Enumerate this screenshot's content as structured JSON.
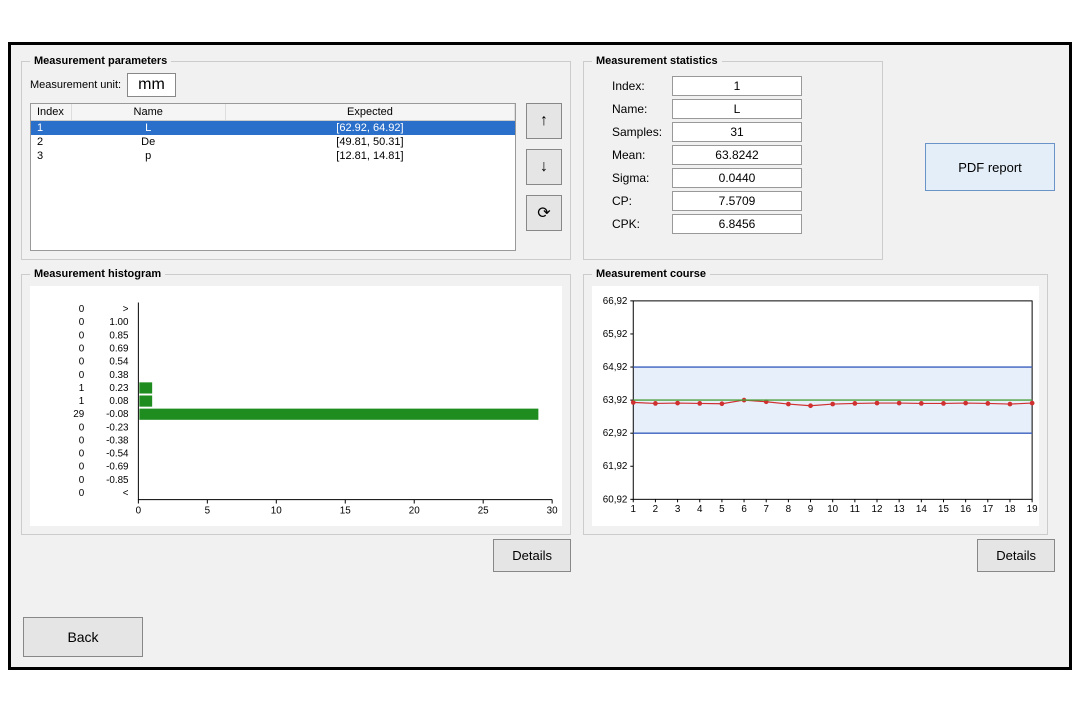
{
  "panels": {
    "parameters_title": "Measurement parameters",
    "statistics_title": "Measurement statistics",
    "histogram_title": "Measurement histogram",
    "course_title": "Measurement course"
  },
  "unit": {
    "label": "Measurement unit:",
    "value": "mm"
  },
  "params_table": {
    "headers": {
      "index": "Index",
      "name": "Name",
      "expected": "Expected"
    },
    "rows": [
      {
        "index": "1",
        "name": "L",
        "expected": "[62.92, 64.92]",
        "selected": true
      },
      {
        "index": "2",
        "name": "De",
        "expected": "[49.81, 50.31]",
        "selected": false
      },
      {
        "index": "3",
        "name": "p",
        "expected": "[12.81, 14.81]",
        "selected": false
      }
    ]
  },
  "icons": {
    "arrow_up": "↑",
    "arrow_down": "↓",
    "refresh": "⟳"
  },
  "statistics": {
    "index": {
      "label": "Index:",
      "value": "1"
    },
    "name": {
      "label": "Name:",
      "value": "L"
    },
    "samples": {
      "label": "Samples:",
      "value": "31"
    },
    "mean": {
      "label": "Mean:",
      "value": "63.8242"
    },
    "sigma": {
      "label": "Sigma:",
      "value": "0.0440"
    },
    "cp": {
      "label": "CP:",
      "value": "7.5709"
    },
    "cpk": {
      "label": "CPK:",
      "value": "6.8456"
    }
  },
  "buttons": {
    "pdf_report": "PDF report",
    "details": "Details",
    "back": "Back"
  },
  "chart_data": [
    {
      "type": "bar",
      "id": "histogram",
      "orientation": "horizontal",
      "bin_labels_inner": [
        ">",
        "1.00",
        "0.85",
        "0.69",
        "0.54",
        "0.38",
        "0.23",
        "0.08",
        "-0.08",
        "-0.23",
        "-0.38",
        "-0.54",
        "-0.69",
        "-0.85",
        "<"
      ],
      "bin_counts": [
        0,
        0,
        0,
        0,
        0,
        0,
        1,
        1,
        29,
        0,
        0,
        0,
        0,
        0,
        0
      ],
      "x_ticks": [
        0,
        5,
        10,
        15,
        20,
        25,
        30
      ],
      "xlim": [
        0,
        30
      ]
    },
    {
      "type": "line",
      "id": "course",
      "x": [
        1,
        2,
        3,
        4,
        5,
        6,
        7,
        8,
        9,
        10,
        11,
        12,
        13,
        14,
        15,
        16,
        17,
        18,
        19
      ],
      "x_ticks": [
        1,
        2,
        3,
        4,
        5,
        6,
        7,
        8,
        9,
        10,
        11,
        12,
        13,
        14,
        15,
        16,
        17,
        18,
        19
      ],
      "series": [
        {
          "name": "measured",
          "color": "#d03030",
          "markers": true,
          "values": [
            63.85,
            63.82,
            63.83,
            63.82,
            63.81,
            63.92,
            63.87,
            63.8,
            63.75,
            63.8,
            63.82,
            63.83,
            63.83,
            63.82,
            63.82,
            63.83,
            63.82,
            63.8,
            63.83
          ]
        },
        {
          "name": "lower_limit",
          "color": "#3a5fbf",
          "markers": false,
          "values": [
            62.92,
            62.92,
            62.92,
            62.92,
            62.92,
            62.92,
            62.92,
            62.92,
            62.92,
            62.92,
            62.92,
            62.92,
            62.92,
            62.92,
            62.92,
            62.92,
            62.92,
            62.92,
            62.92
          ]
        },
        {
          "name": "upper_limit",
          "color": "#3a5fbf",
          "markers": false,
          "values": [
            64.92,
            64.92,
            64.92,
            64.92,
            64.92,
            64.92,
            64.92,
            64.92,
            64.92,
            64.92,
            64.92,
            64.92,
            64.92,
            64.92,
            64.92,
            64.92,
            64.92,
            64.92,
            64.92
          ]
        },
        {
          "name": "mean_line",
          "color": "#4aa03a",
          "markers": false,
          "values": [
            63.92,
            63.92,
            63.92,
            63.92,
            63.92,
            63.92,
            63.92,
            63.92,
            63.92,
            63.92,
            63.92,
            63.92,
            63.92,
            63.92,
            63.92,
            63.92,
            63.92,
            63.92,
            63.92
          ]
        }
      ],
      "y_ticks": [
        60.92,
        61.92,
        62.92,
        63.92,
        64.92,
        65.92,
        66.92
      ],
      "ylim": [
        60.92,
        66.92
      ],
      "band": {
        "y0": 62.92,
        "y1": 64.92,
        "color": "#e6effa"
      }
    }
  ]
}
